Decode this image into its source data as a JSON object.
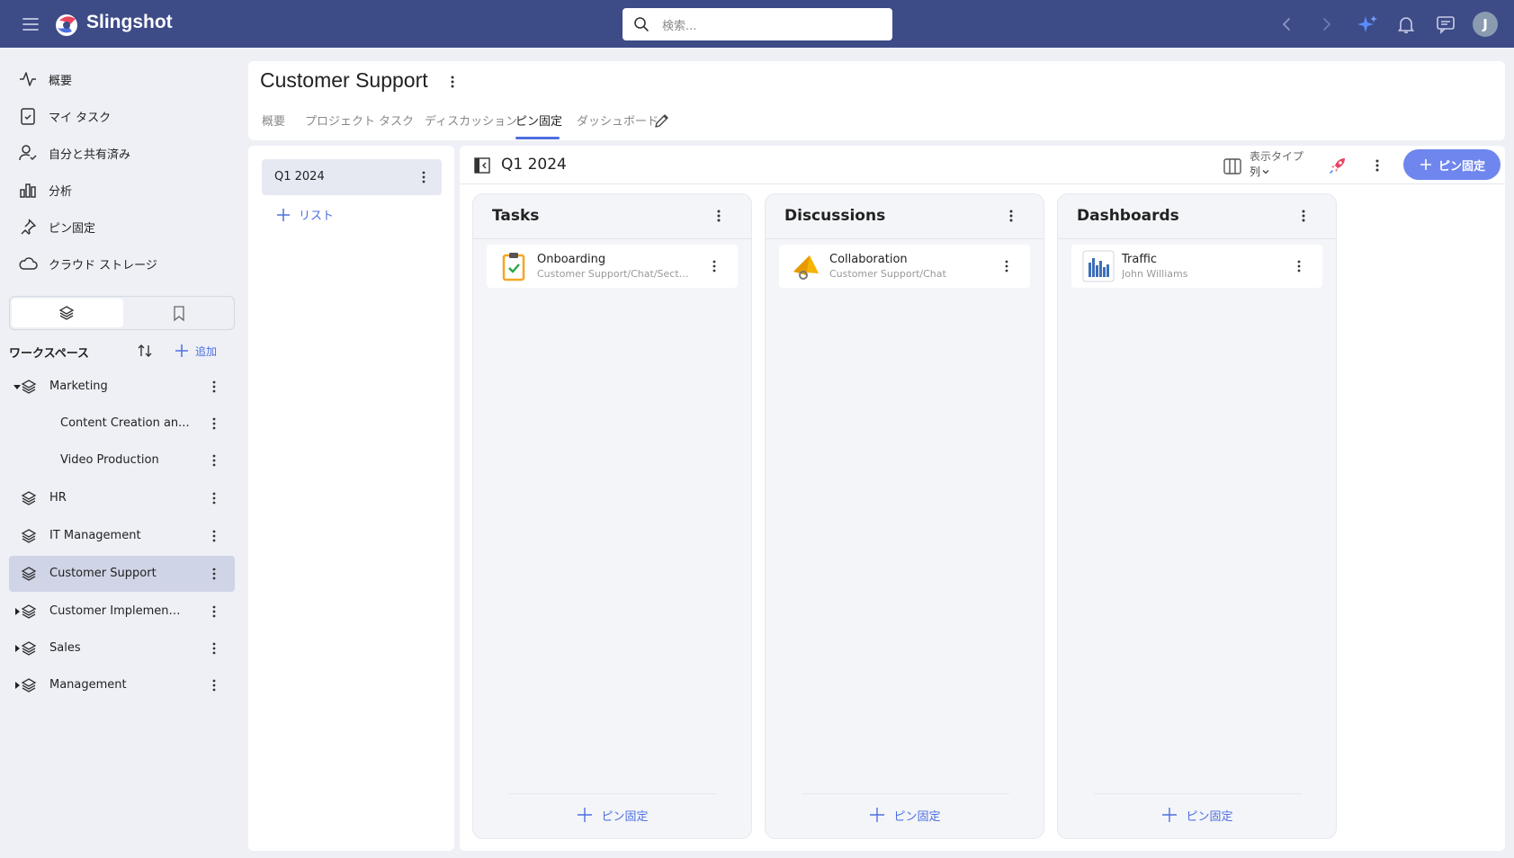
{
  "app": {
    "name": "Slingshot",
    "user_initial": "J"
  },
  "search": {
    "placeholder": "検索..."
  },
  "icons": {
    "menu": "hamburger-icon",
    "logo": "slingshot-logo",
    "search": "search-icon",
    "back": "chevron-left-icon",
    "forward": "chevron-right-icon",
    "ai": "sparkle-icon",
    "notifications": "bell-icon",
    "chat": "chat-icon"
  },
  "colors": {
    "topbar": "#3d4b87",
    "accent": "#4c6fe0",
    "pin_button": "#6f86ee",
    "active_workspace": "#cfd4e6"
  },
  "sidebar": {
    "nav": [
      {
        "label": "概要",
        "icon": "activity-icon"
      },
      {
        "label": "マイ タスク",
        "icon": "clipboard-check-icon"
      },
      {
        "label": "自分と共有済み",
        "icon": "user-check-icon"
      },
      {
        "label": "分析",
        "icon": "bar-chart-icon"
      },
      {
        "label": "ピン固定",
        "icon": "pin-icon"
      },
      {
        "label": "クラウド ストレージ",
        "icon": "cloud-icon"
      }
    ],
    "workspaces_title": "ワークスペース",
    "add_label": "追加",
    "workspaces": [
      {
        "label": "Marketing",
        "expanded": true
      },
      {
        "label": "Content Creation an...",
        "child": true
      },
      {
        "label": "Video Production",
        "child": true
      },
      {
        "label": "HR"
      },
      {
        "label": "IT Management"
      },
      {
        "label": "Customer Support",
        "active": true
      },
      {
        "label": "Customer Implementa...",
        "collapsed": true
      },
      {
        "label": "Sales",
        "collapsed": true
      },
      {
        "label": "Management",
        "collapsed": true
      }
    ]
  },
  "header": {
    "title": "Customer Support",
    "tabs": [
      {
        "label": "概要"
      },
      {
        "label": "プロジェクト"
      },
      {
        "label": "タスク"
      },
      {
        "label": "ディスカッション"
      },
      {
        "label": "ピン固定",
        "active": true
      },
      {
        "label": "ダッシュボード"
      }
    ]
  },
  "lists": {
    "selected": "Q1 2024",
    "add_label": "リスト"
  },
  "main": {
    "title": "Q1 2024",
    "view_type_label": "表示タイプ",
    "view_type_value": "列",
    "pin_button": "ピン固定",
    "columns": [
      {
        "title": "Tasks",
        "cards": [
          {
            "title": "Onboarding",
            "subtitle": "Customer Support/Chat/Secti...",
            "icon": "task-list-icon"
          }
        ],
        "footer": "ピン固定"
      },
      {
        "title": "Discussions",
        "cards": [
          {
            "title": "Collaboration",
            "subtitle": "Customer Support/Chat",
            "icon": "megaphone-icon"
          }
        ],
        "footer": "ピン固定"
      },
      {
        "title": "Dashboards",
        "cards": [
          {
            "title": "Traffic",
            "subtitle": "John Williams",
            "icon": "dashboard-chart-icon"
          }
        ],
        "footer": "ピン固定"
      }
    ]
  }
}
